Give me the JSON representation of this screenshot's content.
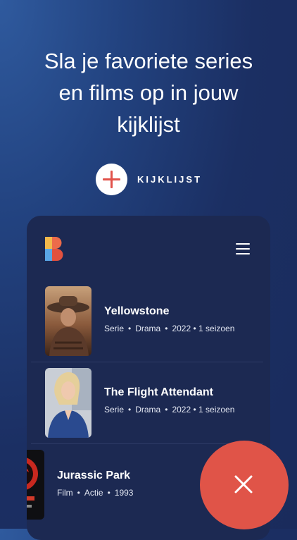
{
  "headline": {
    "line1": "Sla je favoriete series",
    "line2": "en films op in jouw",
    "line3": "kijklijst"
  },
  "cta": {
    "label": "KIJKLIJST",
    "icon": "plus-icon"
  },
  "app": {
    "logo": "app-logo-b",
    "menu_icon": "hamburger-menu-icon",
    "items": [
      {
        "title": "Yellowstone",
        "type": "Serie",
        "genre": "Drama",
        "year": "2022",
        "seasons": "1 seizoen"
      },
      {
        "title": "The Flight Attendant",
        "type": "Serie",
        "genre": "Drama",
        "year": "2022",
        "seasons": "1 seizoen"
      },
      {
        "title": "Jurassic Park",
        "type": "Film",
        "genre": "Actie",
        "year": "1993"
      }
    ]
  },
  "fab": {
    "icon": "close-icon"
  },
  "colors": {
    "background": "#1b2f63",
    "card": "#1c2952",
    "accent": "#e05448"
  }
}
